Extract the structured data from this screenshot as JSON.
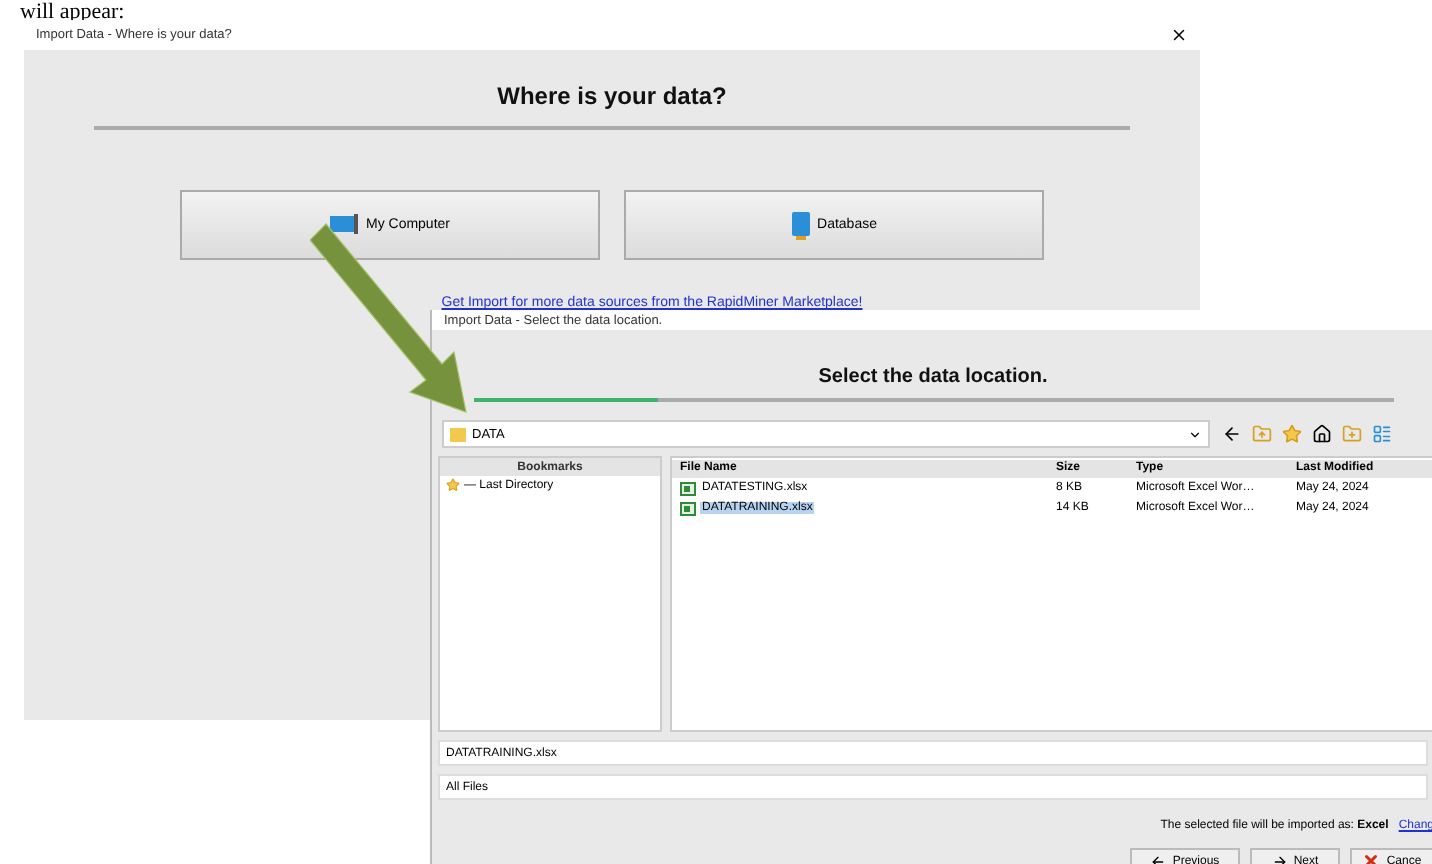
{
  "document_text": "will appear:",
  "back_dialog": {
    "title": "Import Data - Where is your data?",
    "heading": "Where is your data?",
    "sources": [
      {
        "label": "My Computer",
        "kind": "computer"
      },
      {
        "label": "Database",
        "kind": "database"
      }
    ],
    "marketplace_link": "Get Import for more data sources from the RapidMiner Marketplace!"
  },
  "front_dialog": {
    "title": "Import Data - Select the data location.",
    "heading": "Select the data location.",
    "progress": {
      "level": 0.2
    },
    "location": "DATA",
    "bookmarks": {
      "header": "Bookmarks",
      "items": [
        {
          "label": "— Last Directory"
        }
      ]
    },
    "table": {
      "columns": [
        "File Name",
        "Size",
        "Type",
        "Last Modified"
      ],
      "rows": [
        {
          "cells": [
            "DATATESTING.xlsx",
            "8 KB",
            "Microsoft Excel Wor…",
            "May 24, 2024"
          ],
          "selected": false
        },
        {
          "cells": [
            "DATATRAINING.xlsx",
            "14 KB",
            "Microsoft Excel Wor…",
            "May 24, 2024"
          ],
          "selected": true
        }
      ]
    },
    "file_name": "DATATRAINING.xlsx",
    "file_filter": "All Files",
    "import_message": {
      "text": "The selected file will be imported as: **Excel**",
      "link": "Chang"
    },
    "buttons": [
      {
        "label": "Previous",
        "kind": "previous"
      },
      {
        "label": "Next",
        "kind": "next"
      },
      {
        "label": "Cance",
        "kind": "cancel"
      }
    ]
  }
}
